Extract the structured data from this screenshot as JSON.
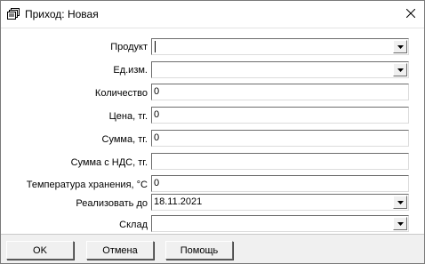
{
  "window": {
    "title": "Приход: Новая",
    "icon": "document-stack-icon",
    "close_icon": "close-icon"
  },
  "form": {
    "product_label": "Продукт",
    "product_value": "",
    "unit_label": "Ед.изм.",
    "unit_value": "",
    "quantity_label": "Количество",
    "quantity_value": "0",
    "price_label": "Цена, тг.",
    "price_value": "0",
    "sum_label": "Сумма, тг.",
    "sum_value": "0",
    "sum_vat_label": "Сумма с НДС, тг.",
    "sum_vat_value": "",
    "storage_temp_label": "Температура хранения, °С",
    "storage_temp_value": "0",
    "sell_by_label": "Реализовать до",
    "sell_by_value": "18.11.2021",
    "warehouse_label": "Склад",
    "warehouse_value": ""
  },
  "buttons": {
    "ok_label": "OK",
    "cancel_label": "Отмена",
    "help_label": "Помощь"
  }
}
